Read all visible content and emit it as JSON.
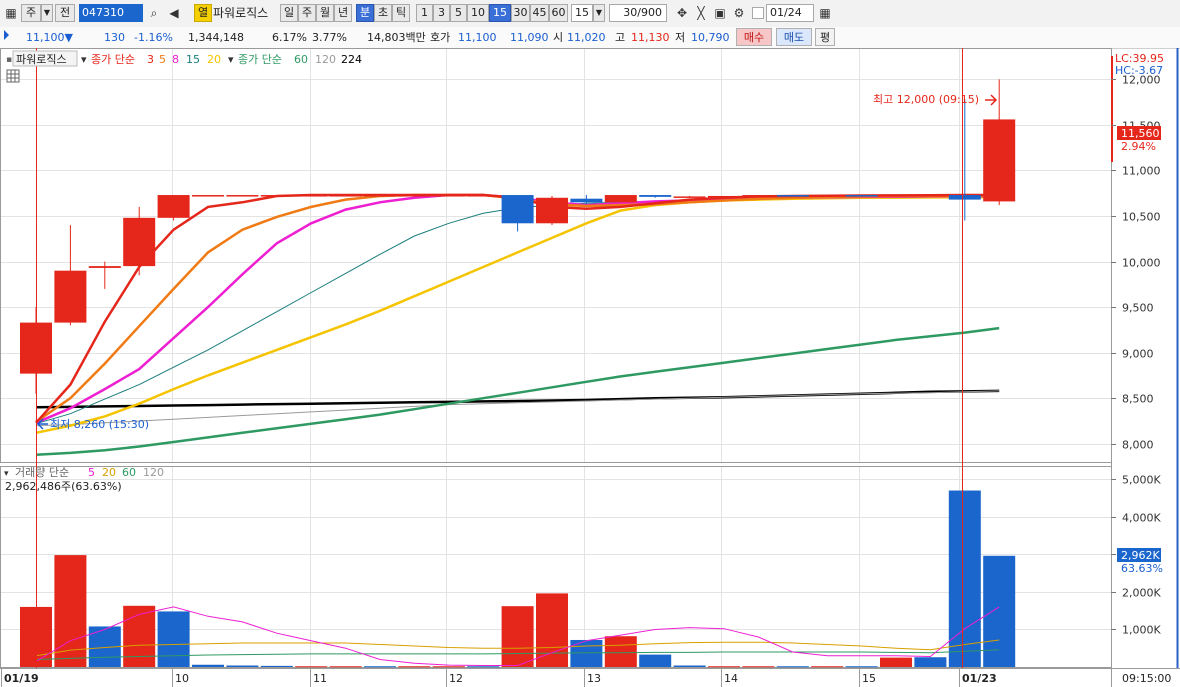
{
  "toolbar": {
    "period_type": "주",
    "prev_label": "전",
    "stock_code": "047310",
    "fav_label": "열",
    "stock_name": "파워로직스",
    "periods": [
      "일",
      "주",
      "월",
      "년",
      "분",
      "초",
      "틱"
    ],
    "active_period": "분",
    "intervals": [
      "1",
      "3",
      "5",
      "10",
      "15",
      "30",
      "45",
      "60"
    ],
    "active_interval": "15",
    "interval_value": "15",
    "count": "30/900",
    "date": "01/24"
  },
  "quote": {
    "price": "11,100▼",
    "change": "130",
    "change_pct": "-1.16%",
    "volume": "1,344,148",
    "turnover_pct": "6.17%",
    "rate2": "3.77%",
    "amount": "14,803백만",
    "ask_label": "호가",
    "ask": "11,100",
    "bid": "11,090",
    "open_label": "시",
    "open": "11,020",
    "high_label": "고",
    "high": "11,130",
    "low_label": "저",
    "low": "10,790",
    "buy_label": "매수",
    "sell_label": "매도",
    "eval_label": "평"
  },
  "price_legend": {
    "name": "파워로직스",
    "ma1_label": "종가 단순",
    "ma1_periods": [
      "3",
      "5",
      "8",
      "15",
      "20"
    ],
    "ma2_label": "종가 단순",
    "ma2_periods": [
      "60",
      "120",
      "224"
    ]
  },
  "volume_legend": {
    "label": "거래량 단순",
    "periods": [
      "5",
      "20",
      "60",
      "120"
    ],
    "value": "2,962,486주(63.63%)"
  },
  "annotations": {
    "high": "최고 12,000 (09:15)",
    "low": "최저 8,260 (15:30)"
  },
  "right_axis": {
    "lc": "LC:39.95",
    "hc": "HC:-3.67",
    "price_ticks": [
      "12,000",
      "11,500",
      "11,000",
      "10,500",
      "10,000",
      "9,500",
      "9,000",
      "8,500",
      "8,000"
    ],
    "current_price": "11,560",
    "current_pct": "2.94%",
    "volume_ticks": [
      "5,000K",
      "4,000K",
      "3,000K",
      "2,000K",
      "1,000K"
    ],
    "current_volume": "2,962K",
    "volume_pct": "63.63%"
  },
  "x_axis": {
    "labels": [
      "01/19",
      "10",
      "11",
      "12",
      "13",
      "14",
      "15",
      "01/23"
    ],
    "time": "09:15:00"
  },
  "colors": {
    "up": "#e5261a",
    "down": "#1a66cc",
    "ma3": "#e5261a",
    "ma5": "#f07a14",
    "ma8": "#ee1fd2",
    "ma15": "#1a7d7d",
    "ma20": "#f5c400",
    "ma60": "#2e9a62",
    "ma120": "#9a9a9a",
    "ma224": "#000000"
  },
  "chart_data": {
    "type": "candlestick",
    "candles": [
      {
        "o": 8770,
        "h": 9500,
        "l": 8550,
        "c": 9330
      },
      {
        "o": 9330,
        "h": 10400,
        "l": 9300,
        "c": 9900
      },
      {
        "o": 9930,
        "h": 10000,
        "l": 9700,
        "c": 9950
      },
      {
        "o": 9950,
        "h": 10600,
        "l": 9850,
        "c": 10480
      },
      {
        "o": 10480,
        "h": 10730,
        "l": 10450,
        "c": 10730
      },
      {
        "o": 10730,
        "h": 10730,
        "l": 10730,
        "c": 10730
      },
      {
        "o": 10730,
        "h": 10730,
        "l": 10730,
        "c": 10730
      },
      {
        "o": 10730,
        "h": 10730,
        "l": 10730,
        "c": 10730
      },
      {
        "o": 10730,
        "h": 10730,
        "l": 10730,
        "c": 10730
      },
      {
        "o": 10730,
        "h": 10730,
        "l": 10730,
        "c": 10730
      },
      {
        "o": 10730,
        "h": 10730,
        "l": 10730,
        "c": 10730
      },
      {
        "o": 10730,
        "h": 10730,
        "l": 10730,
        "c": 10730
      },
      {
        "o": 10730,
        "h": 10730,
        "l": 10730,
        "c": 10730
      },
      {
        "o": 10730,
        "h": 10730,
        "l": 10730,
        "c": 10730
      },
      {
        "o": 10730,
        "h": 10730,
        "l": 10330,
        "c": 10420
      },
      {
        "o": 10420,
        "h": 10720,
        "l": 10400,
        "c": 10700
      },
      {
        "o": 10690,
        "h": 10730,
        "l": 10630,
        "c": 10650
      },
      {
        "o": 10650,
        "h": 10730,
        "l": 10650,
        "c": 10730
      },
      {
        "o": 10730,
        "h": 10730,
        "l": 10700,
        "c": 10710
      },
      {
        "o": 10710,
        "h": 10720,
        "l": 10700,
        "c": 10715
      },
      {
        "o": 10715,
        "h": 10720,
        "l": 10710,
        "c": 10720
      },
      {
        "o": 10720,
        "h": 10730,
        "l": 10715,
        "c": 10730
      },
      {
        "o": 10730,
        "h": 10730,
        "l": 10725,
        "c": 10725
      },
      {
        "o": 10725,
        "h": 10730,
        "l": 10725,
        "c": 10730
      },
      {
        "o": 10730,
        "h": 10730,
        "l": 10720,
        "c": 10720
      },
      {
        "o": 10720,
        "h": 10730,
        "l": 10720,
        "c": 10730
      },
      {
        "o": 10730,
        "h": 10730,
        "l": 10730,
        "c": 10730
      },
      {
        "o": 10730,
        "h": 11780,
        "l": 10450,
        "c": 10680
      },
      {
        "o": 10660,
        "h": 12000,
        "l": 10620,
        "c": 11560
      }
    ],
    "candle_dir": [
      "up",
      "up",
      "up",
      "up",
      "up",
      "up",
      "up",
      "up",
      "up",
      "up",
      "up",
      "up",
      "up",
      "up",
      "down",
      "up",
      "down",
      "up",
      "down",
      "up",
      "up",
      "up",
      "down",
      "up",
      "down",
      "up",
      "up",
      "down",
      "up"
    ],
    "volume": [
      1600,
      2980,
      1080,
      1630,
      1480,
      60,
      40,
      30,
      20,
      20,
      20,
      20,
      20,
      20,
      1620,
      1960,
      720,
      820,
      330,
      40,
      20,
      20,
      20,
      20,
      20,
      250,
      260,
      4700,
      2962
    ],
    "volume_dir": [
      "up",
      "up",
      "down",
      "up",
      "down",
      "down",
      "down",
      "down",
      "up",
      "up",
      "down",
      "up",
      "up",
      "down",
      "up",
      "up",
      "down",
      "up",
      "down",
      "down",
      "up",
      "up",
      "down",
      "up",
      "down",
      "up",
      "down",
      "down",
      "down"
    ],
    "ma_lines": {
      "ma3": [
        8230,
        8650,
        9340,
        9940,
        10350,
        10600,
        10650,
        10720,
        10730,
        10730,
        10730,
        10730,
        10730,
        10730,
        10700,
        10600,
        10580,
        10600,
        10640,
        10680,
        10700,
        10715,
        10720,
        10722,
        10725,
        10726,
        10728,
        10730,
        10730
      ],
      "ma5": [
        8240,
        8500,
        8880,
        9290,
        9700,
        10100,
        10350,
        10490,
        10600,
        10680,
        10720,
        10730,
        10730,
        10730,
        10690,
        10630,
        10610,
        10620,
        10630,
        10650,
        10670,
        10690,
        10700,
        10710,
        10715,
        10718,
        10720,
        10722,
        10725
      ],
      "ma8": [
        8230,
        8390,
        8600,
        8820,
        9160,
        9500,
        9860,
        10200,
        10420,
        10570,
        10650,
        10700,
        10730,
        10730,
        10700,
        10650,
        10620,
        10640,
        10660,
        10670,
        10680,
        10690,
        10700,
        10705,
        10710,
        10712,
        10715,
        10718,
        10720
      ],
      "ma15": [
        8220,
        8330,
        8490,
        8650,
        8840,
        9030,
        9240,
        9450,
        9660,
        9870,
        10080,
        10280,
        10420,
        10530,
        10590,
        10620,
        10640,
        10650,
        10660,
        10670,
        10680,
        10690,
        10695,
        10700,
        10703,
        10706,
        10708,
        10710,
        10712
      ],
      "ma20": [
        8120,
        8200,
        8300,
        8440,
        8600,
        8750,
        8890,
        9030,
        9170,
        9310,
        9460,
        9620,
        9780,
        9940,
        10100,
        10260,
        10420,
        10560,
        10620,
        10650,
        10670,
        10680,
        10690,
        10695,
        10700,
        10702,
        10704,
        10706,
        10708
      ],
      "ma60": [
        7880,
        7900,
        7930,
        7970,
        8020,
        8070,
        8120,
        8170,
        8220,
        8270,
        8320,
        8380,
        8440,
        8500,
        8560,
        8620,
        8680,
        8740,
        8790,
        8840,
        8890,
        8940,
        8990,
        9040,
        9090,
        9140,
        9180,
        9220,
        9270
      ],
      "ma120": [
        8200,
        8210,
        8230,
        8250,
        8270,
        8290,
        8310,
        8330,
        8350,
        8370,
        8390,
        8410,
        8430,
        8440,
        8450,
        8460,
        8470,
        8480,
        8490,
        8500,
        8510,
        8520,
        8530,
        8540,
        8550,
        8555,
        8560,
        8570,
        8580
      ],
      "ma224": [
        8400,
        8405,
        8410,
        8415,
        8420,
        8425,
        8430,
        8435,
        8440,
        8445,
        8450,
        8455,
        8460,
        8465,
        8470,
        8475,
        8480,
        8490,
        8500,
        8505,
        8510,
        8520,
        8530,
        8540,
        8550,
        8560,
        8570,
        8575,
        8580
      ]
    },
    "volume_ma": {
      "v5": [
        150,
        700,
        1000,
        1400,
        1600,
        1350,
        1200,
        900,
        700,
        500,
        200,
        100,
        50,
        40,
        40,
        380,
        700,
        850,
        1000,
        1050,
        1020,
        800,
        400,
        300,
        300,
        300,
        280,
        1020,
        1600
      ],
      "v20": [
        300,
        450,
        520,
        580,
        600,
        620,
        640,
        640,
        640,
        640,
        600,
        560,
        520,
        500,
        500,
        520,
        560,
        580,
        620,
        650,
        660,
        660,
        640,
        600,
        560,
        500,
        460,
        600,
        720
      ],
      "v60": [
        200,
        230,
        260,
        280,
        300,
        320,
        330,
        340,
        350,
        350,
        350,
        350,
        350,
        350,
        360,
        370,
        380,
        380,
        390,
        390,
        400,
        400,
        400,
        400,
        400,
        390,
        380,
        420,
        460
      ]
    },
    "y_range": [
      7800,
      12300
    ],
    "volume_range": [
      0,
      5300
    ]
  }
}
